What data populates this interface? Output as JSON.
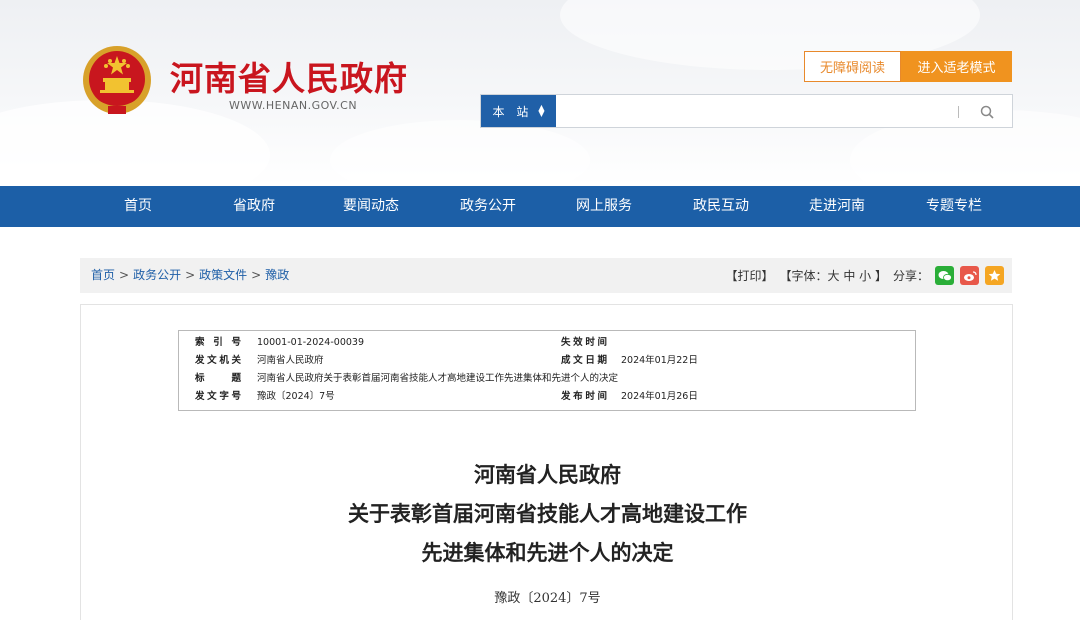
{
  "header": {
    "site_title": "河南省人民政府",
    "site_domain": "WWW.HENAN.GOV.CN",
    "accessible_label": "无障碍阅读",
    "elder_mode_label": "进入适老模式",
    "search": {
      "scope": "本 站",
      "placeholder": ""
    }
  },
  "nav": {
    "items": [
      "首页",
      "省政府",
      "要闻动态",
      "政务公开",
      "网上服务",
      "政民互动",
      "走进河南",
      "专题专栏"
    ]
  },
  "breadcrumb": {
    "items": [
      "首页",
      "政务公开",
      "政策文件",
      "豫政"
    ],
    "separator": ">"
  },
  "tools": {
    "print": "【打印】",
    "font_size": "【字体：大 中 小 】",
    "share": "分享："
  },
  "meta": {
    "index_no_label": "索 引 号",
    "index_no": "10001-01-2024-00039",
    "expire_label": "失效时间",
    "expire": "",
    "issuer_label": "发文机关",
    "issuer": "河南省人民政府",
    "created_label": "成文日期",
    "created": "2024年01月22日",
    "title_label": "标 题",
    "title": "河南省人民政府关于表彰首届河南省技能人才高地建设工作先进集体和先进个人的决定",
    "doc_no_label": "发文字号",
    "doc_no": "豫政〔2024〕7号",
    "published_label": "发布时间",
    "published": "2024年01月26日"
  },
  "document": {
    "title_line1": "河南省人民政府",
    "title_line2": "关于表彰首届河南省技能人才高地建设工作",
    "title_line3": "先进集体和先进个人的决定",
    "doc_no": "豫政〔2024〕7号"
  },
  "colors": {
    "brand_red": "#c9151e",
    "nav_blue": "#1c5fa7",
    "accent_orange": "#f0931f"
  },
  "icons": [
    "national-emblem-icon",
    "search-icon",
    "wechat-icon",
    "weibo-icon",
    "favorite-icon"
  ]
}
